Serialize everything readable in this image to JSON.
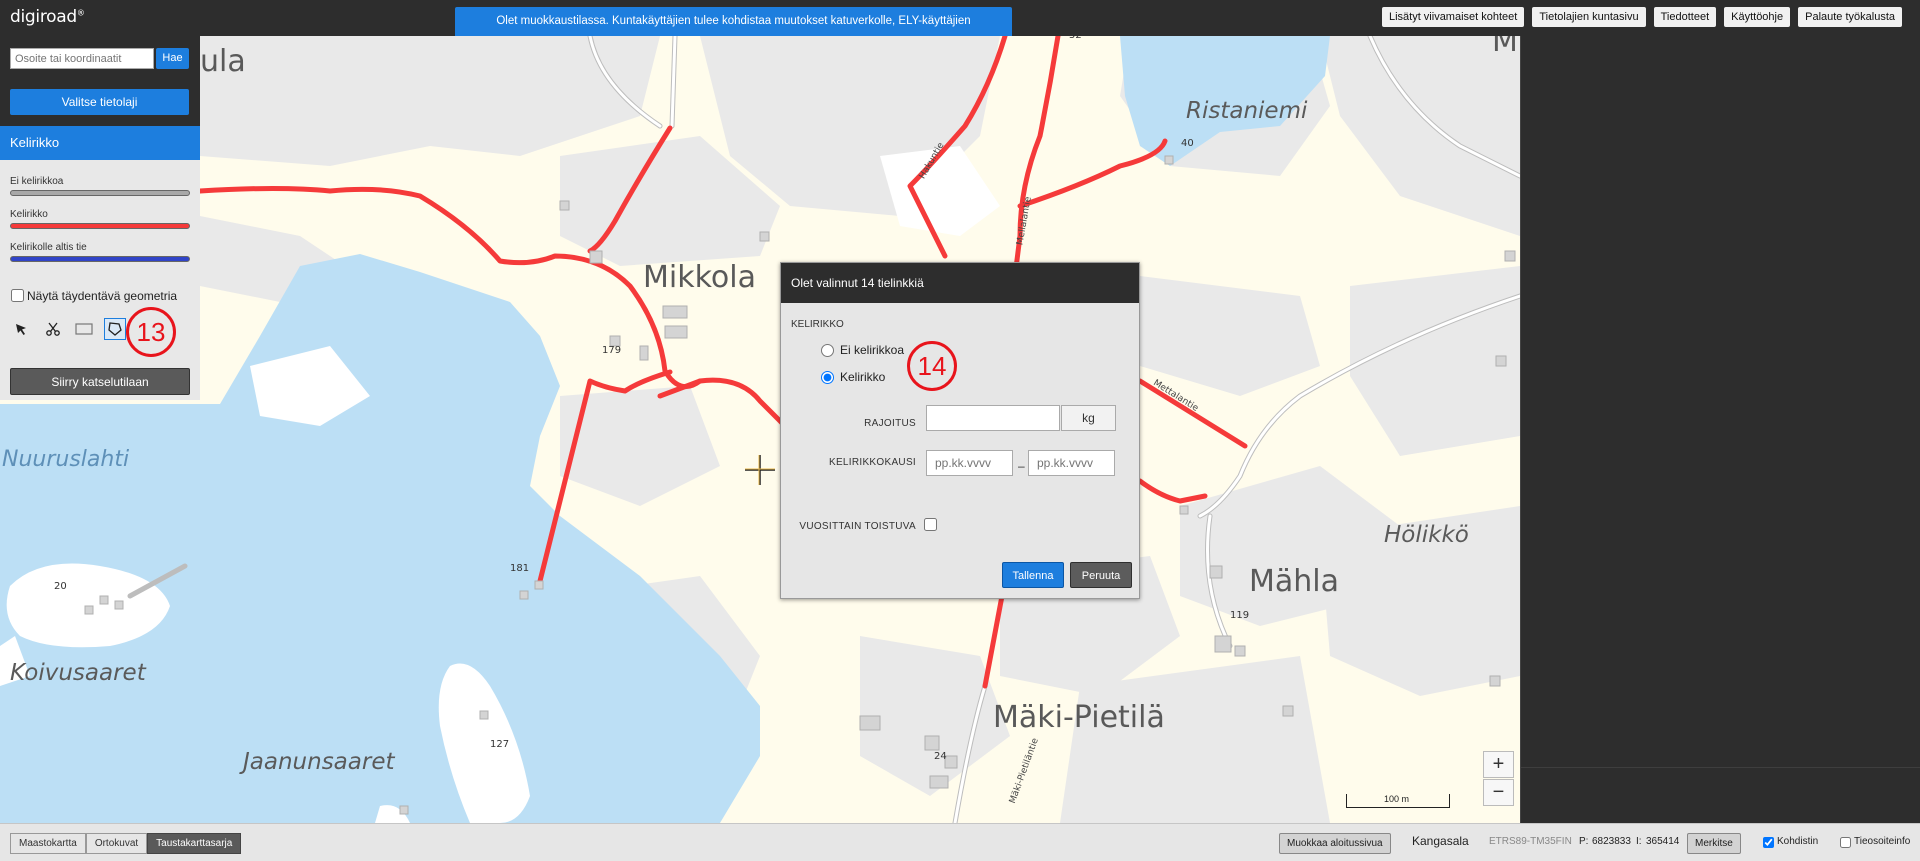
{
  "header": {
    "logo": "digiroad",
    "logo_mark": "®",
    "notice": "Olet muokkaustilassa. Kuntakäyttäjien tulee kohdistaa muutokset katuverkolle, ELY-käyttäjien maantieverkolle.",
    "links": [
      "Lisätyt viivamaiset kohteet",
      "Tietolajien kuntasivu",
      "Tiedotteet",
      "Käyttöohje",
      "Palaute työkalusta"
    ]
  },
  "sidebar": {
    "search_placeholder": "Osoite tai koordinaatit",
    "search_button": "Hae",
    "select_layer_button": "Valitse tietolaji",
    "layer_title": "Kelirikko",
    "legend": [
      {
        "label": "Ei kelirikkoa",
        "color": "#a8a8a8"
      },
      {
        "label": "Kelirikko",
        "color": "#f53a3a"
      },
      {
        "label": "Kelirikolle altis tie",
        "color": "#3044c8"
      }
    ],
    "complementary_geometry_label": "Näytä täydentävä geometria",
    "tools": [
      "select-arrow-icon",
      "cut-scissors-icon",
      "rectangle-select-icon",
      "polygon-select-icon"
    ],
    "view_mode_button": "Siirry katselutilaan"
  },
  "annotations": {
    "marker_13": "13",
    "marker_14": "14"
  },
  "dialog": {
    "title": "Olet valinnut 14 tielinkkiä",
    "section": "KELIRIKKO",
    "options": [
      {
        "label": "Ei kelirikkoa",
        "selected": false
      },
      {
        "label": "Kelirikko",
        "selected": true
      }
    ],
    "limit_label": "RAJOITUS",
    "limit_value": "",
    "limit_unit": "kg",
    "period_label": "KELIRIKKOKAUSI",
    "start_placeholder": "pp.kk.vvvv",
    "end_placeholder": "pp.kk.vvvv",
    "period_separator": "–",
    "yearly_label": "VUOSITTAIN TOISTUVA",
    "yearly_checked": false,
    "save_button": "Tallenna",
    "cancel_button": "Peruuta"
  },
  "map": {
    "labels": {
      "ula": "ula",
      "mikkola": "Mikkola",
      "ristaniemi": "Ristaniemi",
      "nuuruslahti": "Nuuruslahti",
      "koivusaaret": "Koivusaaret",
      "jaanunsaaret": "Jaanunsaaret",
      "holikko": "Hölikkö",
      "mahla": "Mähla",
      "makipietila": "Mäki-Pietilä",
      "mi": "M"
    },
    "road_names": {
      "hakuntie": "Hakuntie",
      "mellalantie": "Mellalantie",
      "mettalantie": "Mettalantie",
      "makipietilantie": "Mäki-Pietiläntie"
    },
    "numbers": {
      "n52": "52",
      "n40": "40",
      "n179": "179",
      "n181": "181",
      "n20": "20",
      "n127": "127",
      "n24": "24",
      "n119": "119"
    },
    "zoom_in": "+",
    "zoom_out": "−",
    "scale_label": "100 m"
  },
  "footer": {
    "background_tabs": [
      {
        "label": "Maastokartta",
        "active": false
      },
      {
        "label": "Ortokuvat",
        "active": false
      },
      {
        "label": "Taustakarttasarja",
        "active": true
      }
    ],
    "edit_start_page": "Muokkaa aloitussivua",
    "municipality": "Kangasala",
    "crs": "ETRS89-TM35FIN",
    "p_label": "P:",
    "p_value": "6823833",
    "i_label": "I:",
    "i_value": "365414",
    "mark_button": "Merkitse",
    "cursor_label": "Kohdistin",
    "cursor_checked": true,
    "road_info_label": "Tieosoiteinfo",
    "road_info_checked": false
  },
  "colors": {
    "accent": "#1d7ede",
    "road_selected": "#f53a3a",
    "water": "#bcdff5",
    "land_green": "#e8e8e8",
    "land_field": "#fffcec"
  }
}
